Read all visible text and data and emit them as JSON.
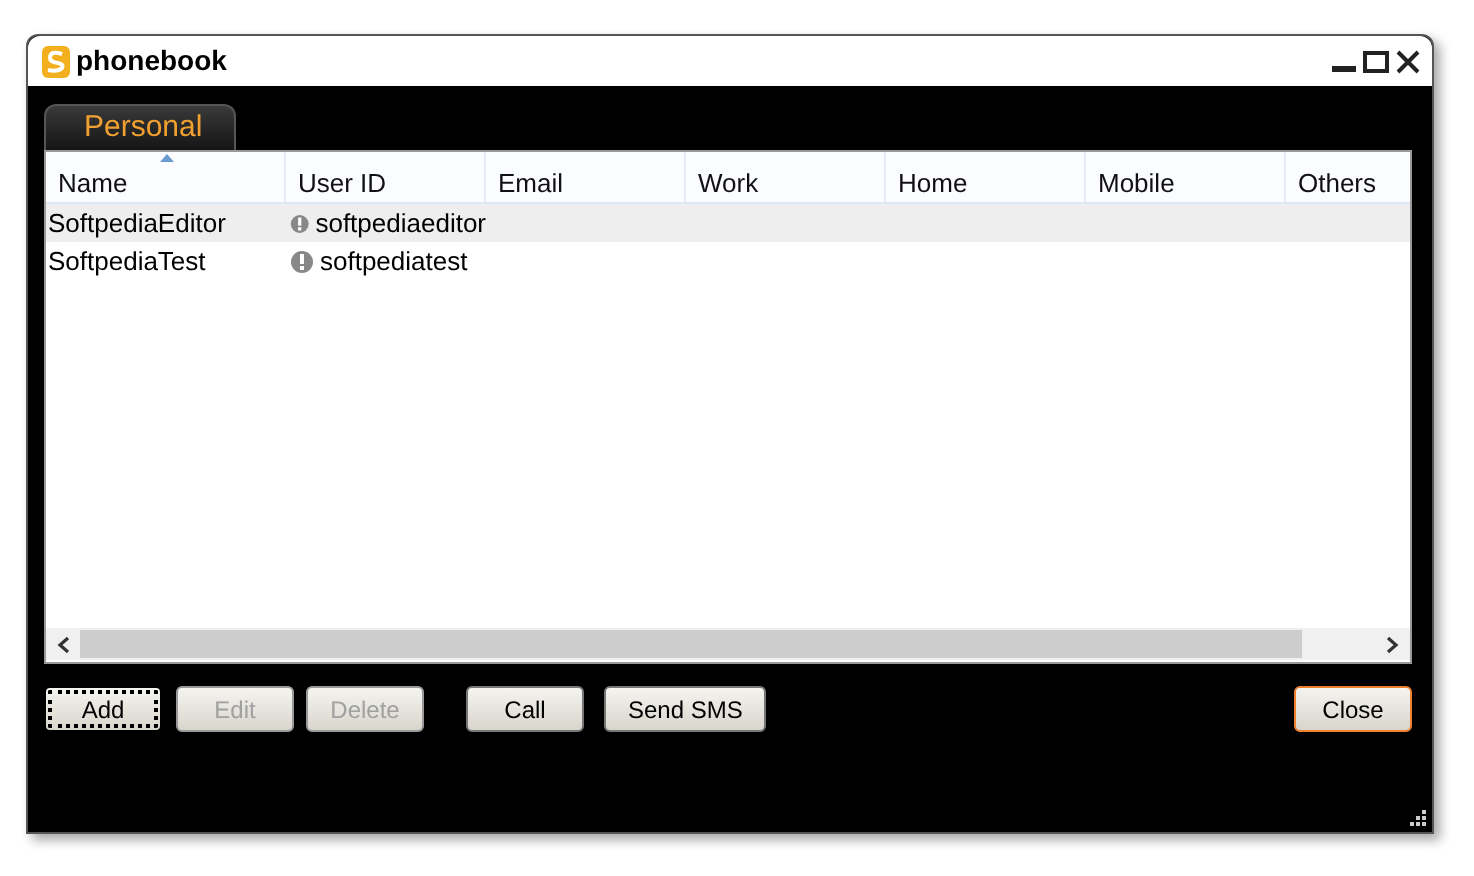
{
  "window": {
    "title": "phonebook"
  },
  "tabs": [
    {
      "label": "Personal",
      "selected": true
    }
  ],
  "table": {
    "columns": [
      {
        "label": "Name",
        "sorted": true
      },
      {
        "label": "User ID",
        "sorted": false
      },
      {
        "label": "Email",
        "sorted": false
      },
      {
        "label": "Work",
        "sorted": false
      },
      {
        "label": "Home",
        "sorted": false
      },
      {
        "label": "Mobile",
        "sorted": false
      },
      {
        "label": "Others",
        "sorted": false
      }
    ],
    "rows": [
      {
        "selected": true,
        "cells": [
          "SoftpediaEditor",
          "softpediaeditor"
        ]
      },
      {
        "selected": false,
        "cells": [
          "SoftpediaTest",
          "softpediatest"
        ]
      }
    ]
  },
  "buttons": [
    {
      "label": "Add",
      "disabled": false,
      "focused": true,
      "default": false
    },
    {
      "label": "Edit",
      "disabled": true,
      "focused": false,
      "default": false
    },
    {
      "label": "Delete",
      "disabled": true,
      "focused": false,
      "default": false
    },
    {
      "label": "Call",
      "disabled": false,
      "focused": false,
      "default": false
    },
    {
      "label": "Send SMS",
      "disabled": false,
      "focused": false,
      "default": false
    },
    {
      "label": "Close",
      "disabled": false,
      "focused": false,
      "default": true
    }
  ]
}
